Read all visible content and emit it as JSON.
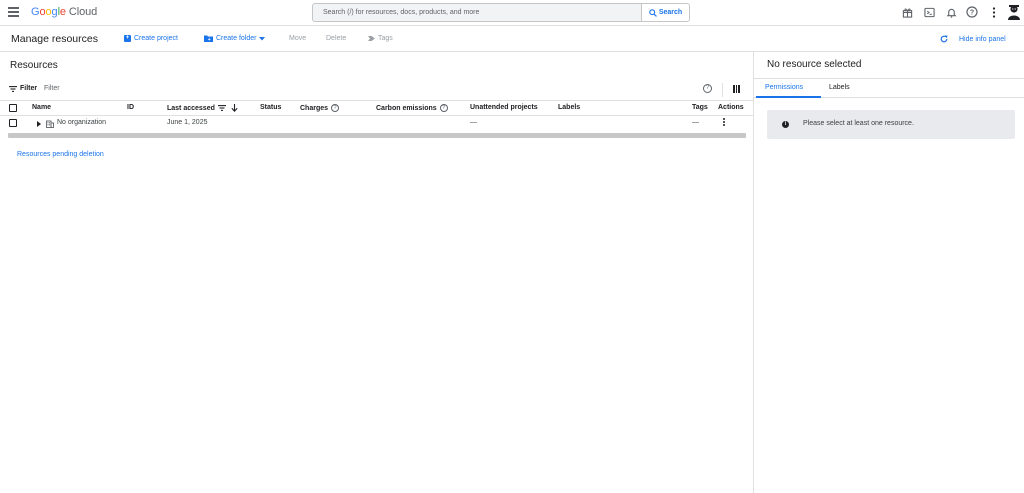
{
  "topbar": {
    "logo_google": "Google",
    "logo_cloud": "Cloud",
    "search_placeholder": "Search (/) for resources, docs, products, and more",
    "search_button": "Search",
    "icons": [
      "gift-icon",
      "terminal-icon",
      "bell-icon",
      "help-icon",
      "more-vert-icon",
      "avatar"
    ]
  },
  "actionbar": {
    "title": "Manage resources",
    "create_project": "Create project",
    "create_folder": "Create folder",
    "move": "Move",
    "delete": "Delete",
    "tags": "Tags",
    "hide_info_panel": "Hide info panel"
  },
  "resources": {
    "title": "Resources",
    "filter_label": "Filter",
    "filter_placeholder": "Filter",
    "columns": {
      "name": "Name",
      "id": "ID",
      "last_accessed": "Last accessed",
      "status": "Status",
      "charges": "Charges",
      "carbon": "Carbon emissions",
      "unattended": "Unattended projects",
      "labels": "Labels",
      "tags": "Tags",
      "actions": "Actions"
    },
    "rows": [
      {
        "name": "No organization",
        "last_accessed": "June 1, 2025",
        "unattended": "—",
        "tags": "—"
      }
    ],
    "pending_link": "Resources pending deletion"
  },
  "info_panel": {
    "title": "No resource selected",
    "tabs": [
      "Permissions",
      "Labels"
    ],
    "active_tab": "Permissions",
    "notice": "Please select at least one resource."
  },
  "colors": {
    "accent": "#1a73e8",
    "border": "#e0e0e0",
    "notice_bg": "#e8eaed"
  }
}
